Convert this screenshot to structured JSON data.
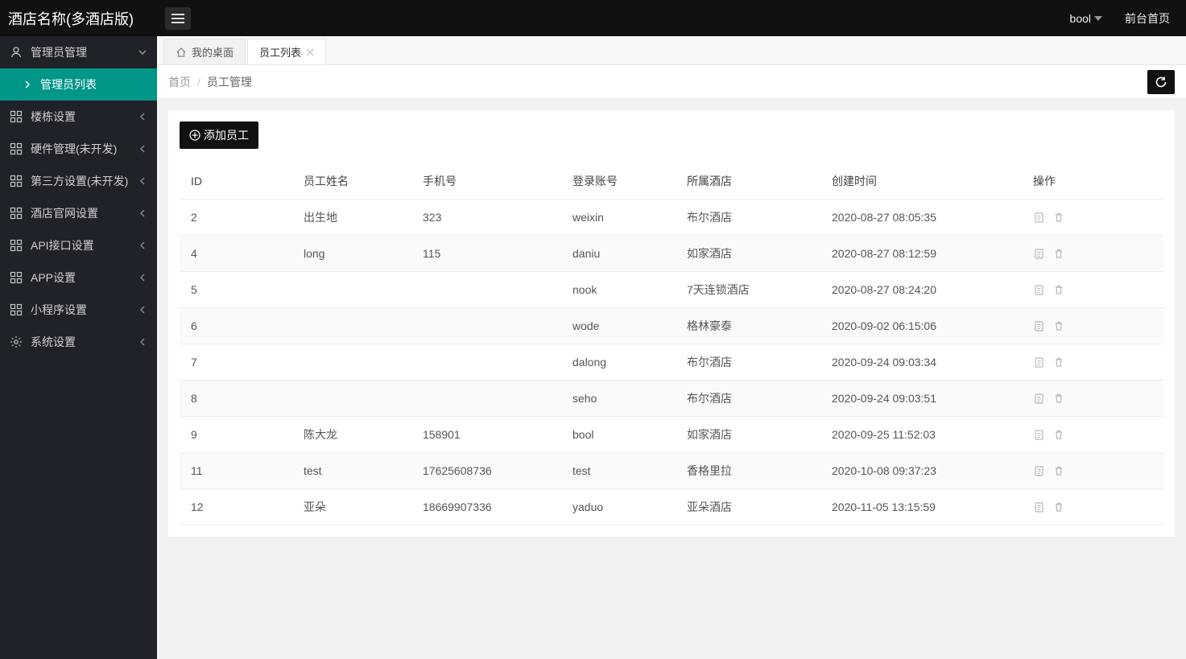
{
  "brand": "酒店名称(多酒店版)",
  "topbar": {
    "user": "bool",
    "front_link": "前台首页"
  },
  "sidebar": {
    "items": [
      {
        "label": "管理员管理",
        "type": "group-expanded",
        "icon": "user"
      },
      {
        "label": "管理员列表",
        "type": "sub-active"
      },
      {
        "label": "楼栋设置",
        "type": "group",
        "icon": "grid"
      },
      {
        "label": "硬件管理(未开发)",
        "type": "group",
        "icon": "grid"
      },
      {
        "label": "第三方设置(未开发)",
        "type": "group",
        "icon": "grid"
      },
      {
        "label": "酒店官网设置",
        "type": "group",
        "icon": "grid"
      },
      {
        "label": "API接口设置",
        "type": "group",
        "icon": "grid"
      },
      {
        "label": "APP设置",
        "type": "group",
        "icon": "grid"
      },
      {
        "label": "小程序设置",
        "type": "group",
        "icon": "grid"
      },
      {
        "label": "系统设置",
        "type": "group",
        "icon": "gear"
      }
    ]
  },
  "tabs": [
    {
      "label": "我的桌面",
      "closable": false
    },
    {
      "label": "员工列表",
      "closable": true,
      "active": true
    }
  ],
  "breadcrumb": {
    "home": "首页",
    "current": "员工管理"
  },
  "buttons": {
    "add": "添加员工"
  },
  "table": {
    "columns": [
      "ID",
      "员工姓名",
      "手机号",
      "登录账号",
      "所属酒店",
      "创建时间",
      "操作"
    ],
    "rows": [
      {
        "id": "2",
        "name": "出生地",
        "phone": "323",
        "login": "weixin",
        "hotel": "布尔酒店",
        "created": "2020-08-27 08:05:35"
      },
      {
        "id": "4",
        "name": "long",
        "phone": "115",
        "login": "daniu",
        "hotel": "如家酒店",
        "created": "2020-08-27 08:12:59"
      },
      {
        "id": "5",
        "name": "",
        "phone": "",
        "login": "nook",
        "hotel": "7天连锁酒店",
        "created": "2020-08-27 08:24:20"
      },
      {
        "id": "6",
        "name": "",
        "phone": "",
        "login": "wode",
        "hotel": "格林豪泰",
        "created": "2020-09-02 06:15:06"
      },
      {
        "id": "7",
        "name": "",
        "phone": "",
        "login": "dalong",
        "hotel": "布尔酒店",
        "created": "2020-09-24 09:03:34"
      },
      {
        "id": "8",
        "name": "",
        "phone": "",
        "login": "seho",
        "hotel": "布尔酒店",
        "created": "2020-09-24 09:03:51"
      },
      {
        "id": "9",
        "name": "陈大龙",
        "phone": "158901",
        "login": "bool",
        "hotel": "如家酒店",
        "created": "2020-09-25 11:52:03"
      },
      {
        "id": "11",
        "name": "test",
        "phone": "17625608736",
        "login": "test",
        "hotel": "香格里拉",
        "created": "2020-10-08 09:37:23"
      },
      {
        "id": "12",
        "name": "亚朵",
        "phone": "18669907336",
        "login": "yaduo",
        "hotel": "亚朵酒店",
        "created": "2020-11-05 13:15:59"
      }
    ]
  }
}
